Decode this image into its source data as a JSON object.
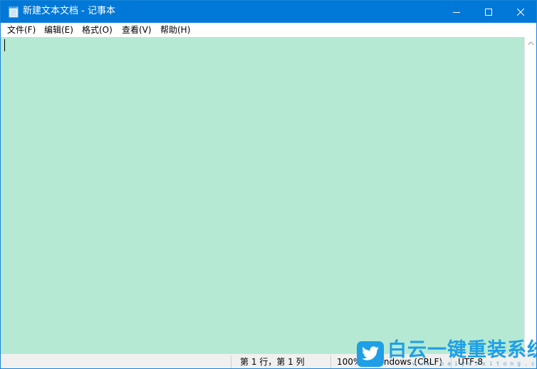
{
  "window": {
    "title": "新建文本文档 - 记事本",
    "icon": "notepad-icon",
    "controls": [
      "minimize-icon",
      "maximize-icon",
      "close-icon"
    ]
  },
  "menu": {
    "items": [
      {
        "label": "文件(F)"
      },
      {
        "label": "编辑(E)"
      },
      {
        "label": "格式(O)"
      },
      {
        "label": "查看(V)"
      },
      {
        "label": "帮助(H)"
      }
    ]
  },
  "editor": {
    "content": "",
    "background": "#b6e9d3"
  },
  "status": {
    "position": "第 1 行，第 1 列",
    "zoom": "100%",
    "line_ending": "Windows (CRLF)",
    "encoding": "UTF-8"
  },
  "watermark": {
    "brand": "白云一键重装系统",
    "url": "www.baiyunxitong.com",
    "icon": "twitter-bird-icon"
  },
  "colors": {
    "titlebar": "#0078d7",
    "accent": "#1e9fe6"
  }
}
